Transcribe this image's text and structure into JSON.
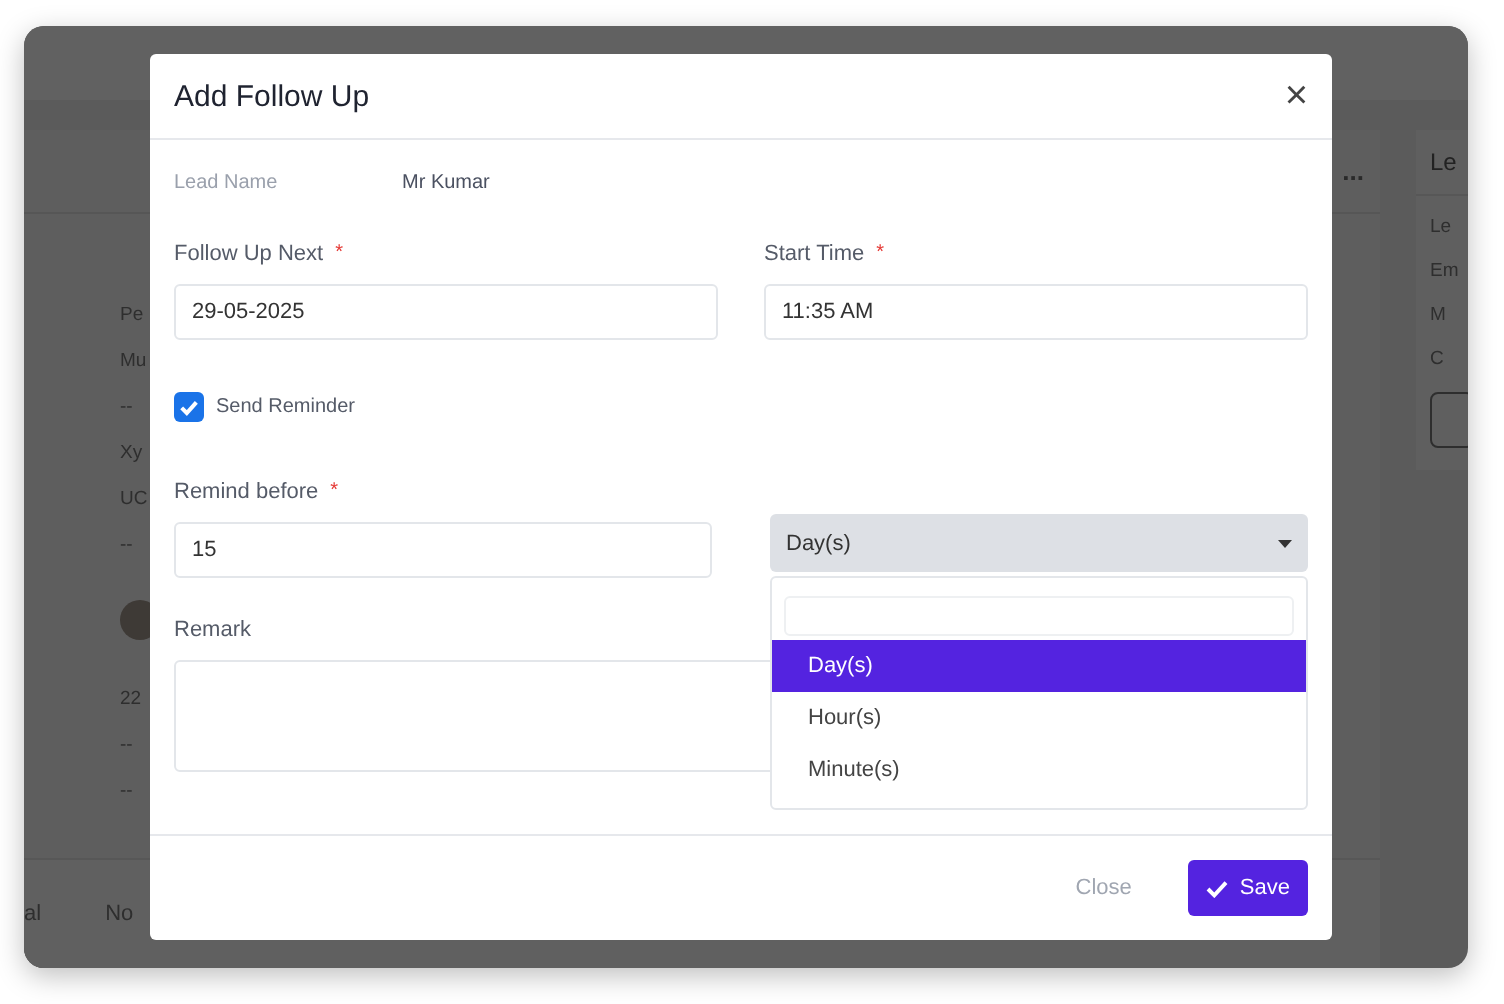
{
  "background": {
    "more": "...",
    "left_rows": [
      "Pe",
      "Mu",
      "--",
      "Xy",
      "UC",
      "--"
    ],
    "left_rows_2": [
      "22",
      "--",
      "--"
    ],
    "tabs": [
      "al",
      "No"
    ],
    "right_card": {
      "title": "Le",
      "rows": [
        "Le",
        "Em",
        "M",
        "C"
      ]
    }
  },
  "modal": {
    "title": "Add Follow Up",
    "close": "×",
    "lead": {
      "label": "Lead Name",
      "value": "Mr Kumar"
    },
    "follow_up_next": {
      "label": "Follow Up Next",
      "required_mark": "*",
      "value": "29-05-2025"
    },
    "start_time": {
      "label": "Start Time",
      "required_mark": "*",
      "value": "11:35 AM"
    },
    "send_reminder": {
      "label": "Send Reminder",
      "checked": true
    },
    "remind_before": {
      "label": "Remind before",
      "required_mark": "*",
      "value": "15"
    },
    "unit_select": {
      "value": "Day(s)",
      "expanded": true,
      "options": [
        {
          "label": "Day(s)",
          "selected": true
        },
        {
          "label": "Hour(s)",
          "selected": false
        },
        {
          "label": "Minute(s)",
          "selected": false
        }
      ]
    },
    "remark": {
      "label": "Remark"
    },
    "buttons": [
      {
        "label": "Close",
        "kind": "secondary"
      },
      {
        "label": "Save",
        "kind": "primary"
      }
    ]
  }
}
